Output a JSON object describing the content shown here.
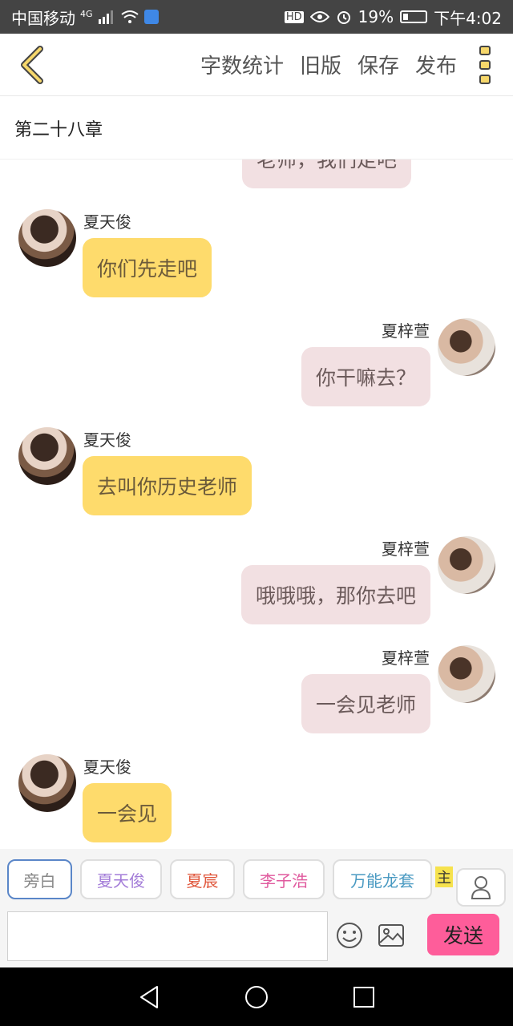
{
  "status_bar": {
    "carrier": "中国移动",
    "network": "4G",
    "battery": "19%",
    "time": "下午4:02",
    "hd": "HD"
  },
  "header": {
    "actions": [
      "字数统计",
      "旧版",
      "保存",
      "发布"
    ]
  },
  "chapter": {
    "title": "第二十八章"
  },
  "chat": {
    "partial_text": "老师，我们走吧",
    "messages": [
      {
        "sender": "夏天俊",
        "side": "left",
        "text": "你们先走吧"
      },
      {
        "sender": "夏梓萱",
        "side": "right",
        "text": "你干嘛去？"
      },
      {
        "sender": "夏天俊",
        "side": "left",
        "text": "去叫你历史老师"
      },
      {
        "sender": "夏梓萱",
        "side": "right",
        "text": "哦哦哦，那你去吧"
      },
      {
        "sender": "夏梓萱",
        "side": "right",
        "text": "一会见老师"
      },
      {
        "sender": "夏天俊",
        "side": "left",
        "text": "一会见"
      }
    ]
  },
  "characters": {
    "chips": [
      {
        "label": "旁白",
        "color": "#888888"
      },
      {
        "label": "夏天俊",
        "color": "#a37cd8"
      },
      {
        "label": "夏宸",
        "color": "#e0573c"
      },
      {
        "label": "李子浩",
        "color": "#e05a9e"
      },
      {
        "label": "万能龙套",
        "color": "#4a9ac2"
      }
    ],
    "main_tag": "主"
  },
  "composer": {
    "value": "",
    "send_label": "发送"
  },
  "colors": {
    "accent_yellow": "#fedb6c",
    "bubble_pink": "#f2e0e2",
    "send_pink": "#fe5d9a"
  },
  "icons": [
    "back-chevron-icon",
    "menu-dots-icon",
    "emoji-icon",
    "image-icon",
    "person-icon",
    "nav-back-icon",
    "nav-home-icon",
    "nav-recents-icon"
  ]
}
